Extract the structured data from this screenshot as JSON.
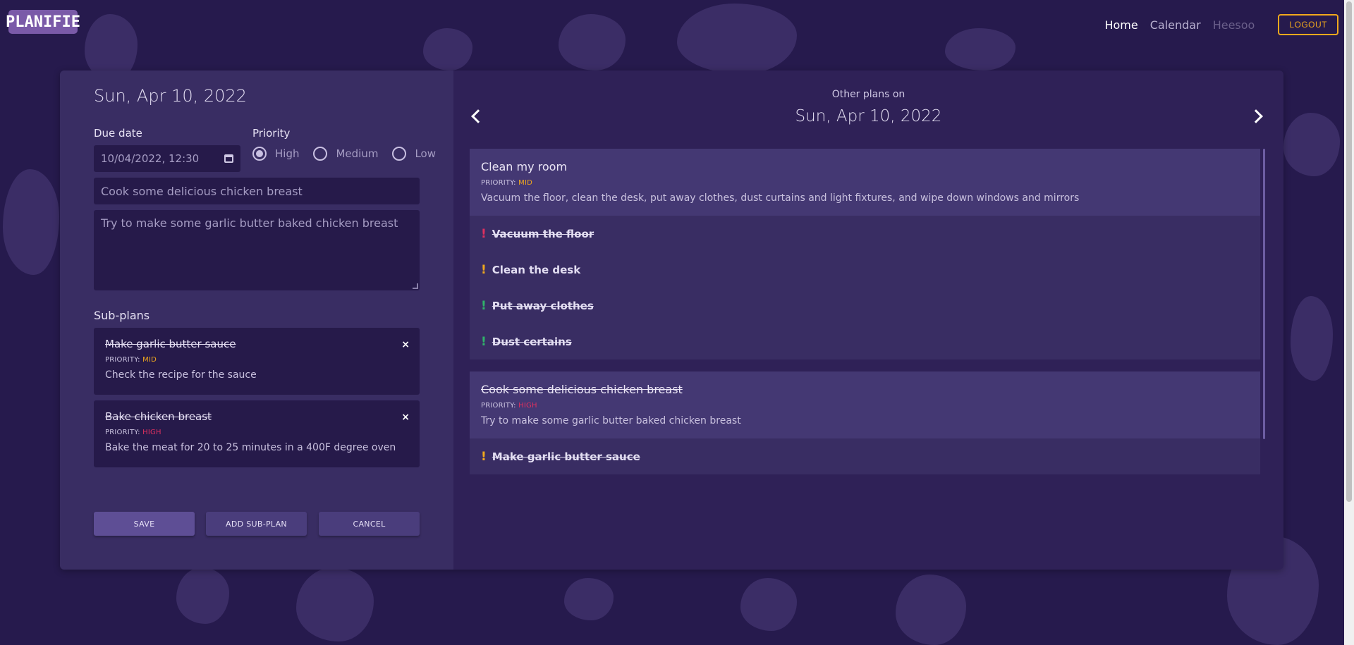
{
  "brand": {
    "logo_text": "PLANIFIE"
  },
  "nav": {
    "home": "Home",
    "calendar": "Calendar",
    "user": "Heesoo",
    "logout": "LOGOUT"
  },
  "form": {
    "date_title": "Sun, Apr 10, 2022",
    "due_date_label": "Due date",
    "due_date_value": "10/04/2022, 12:30",
    "priority_label": "Priority",
    "priority_options": [
      "High",
      "Medium",
      "Low"
    ],
    "priority_selected": "High",
    "title_value": "Cook some delicious chicken breast",
    "description_value": "Try to make some garlic butter baked chicken breast",
    "subplans_label": "Sub-plans",
    "priority_prefix": "PRIORITY:",
    "close_glyph": "×",
    "subplans": [
      {
        "title": "Make garlic butter sauce",
        "priority": "MID",
        "description": "Check the recipe for the sauce"
      },
      {
        "title": "Bake chicken breast",
        "priority": "HIGH",
        "description": "Bake the meat for 20 to 25 minutes in a 400F degree oven"
      }
    ],
    "buttons": {
      "save": "SAVE",
      "add_subplan": "ADD SUB-PLAN",
      "cancel": "CANCEL"
    }
  },
  "other": {
    "label": "Other plans on",
    "date": "Sun, Apr 10, 2022",
    "priority_prefix": "PRIORITY:",
    "plans": [
      {
        "title": "Clean my room",
        "priority": "MID",
        "description": "Vacuum the floor, clean the desk, put away clothes, dust curtains and light fixtures, and wipe down windows and mirrors",
        "items": [
          "Vacuum the floor",
          "Clean the desk",
          "Put away clothes",
          "Dust certains"
        ]
      },
      {
        "title": "Cook some delicious chicken breast",
        "priority": "HIGH",
        "description": "Try to make some garlic butter baked chicken breast",
        "items": [
          "Make garlic butter sauce"
        ]
      }
    ]
  },
  "colors": {
    "high": "#e0305f",
    "mid": "#f0a81d",
    "low": "#2fb36a",
    "accent": "#f0a81d"
  }
}
